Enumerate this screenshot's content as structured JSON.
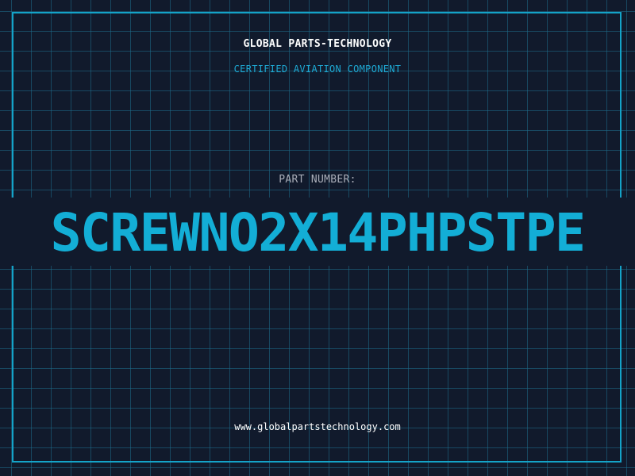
{
  "header": {
    "company": "GLOBAL PARTS-TECHNOLOGY",
    "subtitle": "CERTIFIED AVIATION COMPONENT"
  },
  "part": {
    "label": "PART NUMBER:",
    "number": "SCREWNO2X14PHPSTPE"
  },
  "footer": {
    "website": "www.globalpartstechnology.com"
  },
  "colors": {
    "background": "#111a2c",
    "grid": "#1e6e8c",
    "accent": "#13aed6",
    "text": "#ffffff",
    "label": "#a9adb8"
  }
}
